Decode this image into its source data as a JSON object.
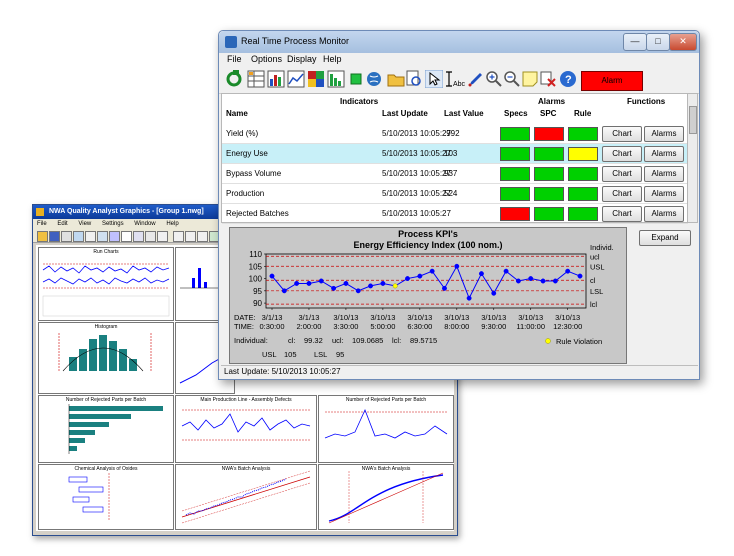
{
  "background_window": {
    "title": "NWA Quality Analyst Graphics - [Group 1.nwg]",
    "menu": [
      "File",
      "Edit",
      "View",
      "Settings",
      "Window",
      "Help"
    ],
    "cells": [
      {
        "title": "Run Charts"
      },
      {
        "title": ""
      },
      {
        "title": "Histogram"
      },
      {
        "title": ""
      },
      {
        "title": "Number of Rejected Parts per Batch"
      },
      {
        "title": "Main Production Line - Assembly Defects"
      },
      {
        "title": "Number of Rejected Parts per Batch"
      },
      {
        "title": "Chemical Analysis of Oxides"
      },
      {
        "title": "NWA's Batch Analysis"
      },
      {
        "title": "NWA's Batch Analysis"
      }
    ]
  },
  "window": {
    "title": "Real Time Process Monitor",
    "controls": {
      "minimize": "—",
      "maximize": "□",
      "close": "✕"
    }
  },
  "menu": [
    "File",
    "Options",
    "Display",
    "Help"
  ],
  "toolbar": {
    "alarm_label": "Alarm",
    "icons": [
      "refresh-icon",
      "table-icon",
      "bar-chart-icon",
      "grid-chart-icon",
      "color-grid-icon",
      "pareto-icon",
      "green-square-icon",
      "globe-icon",
      "open-folder-icon",
      "print-preview-icon",
      "pointer-icon",
      "text-cursor-icon",
      "pen-icon",
      "zoom-in-icon",
      "zoom-out-icon",
      "note-icon",
      "delete-icon",
      "help-icon",
      "stop-icon"
    ],
    "colors": {
      "alarm": "#ff0000"
    }
  },
  "indicators": {
    "group_headers": {
      "indicators": "Indicators",
      "alarms": "Alarms",
      "functions": "Functions"
    },
    "columns": {
      "name": "Name",
      "last_update": "Last Update",
      "last_value": "Last Value",
      "specs": "Specs",
      "spc": "SPC",
      "rule": "Rule"
    },
    "chart_button": "Chart",
    "alarms_button": "Alarms",
    "rows": [
      {
        "name": "Yield (%)",
        "last_update": "5/10/2013 10:05:27",
        "last_value": ".992",
        "specs": "#00d000",
        "spc": "#ff0000",
        "rule": "#00d000",
        "selected": false
      },
      {
        "name": "Energy Use",
        "last_update": "5/10/2013 10:05:27",
        "last_value": "103",
        "specs": "#00d000",
        "spc": "#00d000",
        "rule": "#ffff00",
        "selected": true
      },
      {
        "name": "Bypass Volume",
        "last_update": "5/10/2013 10:05:27",
        "last_value": "937",
        "specs": "#00d000",
        "spc": "#00d000",
        "rule": "#00d000",
        "selected": false
      },
      {
        "name": "Production",
        "last_update": "5/10/2013 10:05:27",
        "last_value": "524",
        "specs": "#00d000",
        "spc": "#00d000",
        "rule": "#00d000",
        "selected": false
      },
      {
        "name": "Rejected Batches",
        "last_update": "5/10/2013 10:05:27",
        "last_value": "",
        "specs": "#ff0000",
        "spc": "#00d000",
        "rule": "#00d000",
        "selected": false
      }
    ]
  },
  "expand_button": "Expand",
  "status_bar": "Last Update: 5/10/2013 10:05:27",
  "chart_data": {
    "type": "line",
    "title": "Process KPI's",
    "subtitle": "Energy Efficiency Index (100 nom.)",
    "ylim": [
      88,
      110
    ],
    "yticks": [
      90,
      95,
      100,
      105,
      110
    ],
    "values": [
      101,
      95,
      98,
      98,
      99,
      96,
      98,
      95,
      97,
      98,
      97,
      100,
      101,
      103,
      96,
      105,
      92,
      102,
      94,
      103,
      99,
      100,
      99,
      99,
      103,
      101
    ],
    "rule_violation_index": 10,
    "limits": {
      "ucl": 109.0685,
      "cl": 99.32,
      "lcl": 89.5715,
      "usl": 105,
      "lsl": 95
    },
    "right_labels": {
      "series": "Individ.",
      "ucl": "ucl",
      "usl": "USL",
      "cl": "cl",
      "lsl": "LSL",
      "lcl": "lcl"
    },
    "row_labels": {
      "date": "DATE:",
      "time": "TIME:"
    },
    "x_ticks": [
      {
        "index": 0,
        "date": "3/1/13",
        "time": "0:30:00"
      },
      {
        "index": 3,
        "date": "3/1/13",
        "time": "2:00:00"
      },
      {
        "index": 6,
        "date": "3/10/13",
        "time": "3:30:00"
      },
      {
        "index": 9,
        "date": "3/10/13",
        "time": "5:00:00"
      },
      {
        "index": 12,
        "date": "3/10/13",
        "time": "6:30:00"
      },
      {
        "index": 15,
        "date": "3/10/13",
        "time": "8:00:00"
      },
      {
        "index": 18,
        "date": "3/10/13",
        "time": "9:30:00"
      },
      {
        "index": 21,
        "date": "3/10/13",
        "time": "11:00:00"
      },
      {
        "index": 24,
        "date": "3/10/13",
        "time": "12:30:00"
      }
    ],
    "stats": {
      "label": "Individual:",
      "cl_label": "cl:",
      "cl": "99.32",
      "ucl_label": "ucl:",
      "ucl": "109.0685",
      "lcl_label": "lcl:",
      "lcl": "89.5715",
      "usl_label": "USL",
      "usl": "105",
      "lsl_label": "LSL",
      "lsl": "95"
    },
    "legend": "Rule Violation",
    "colors": {
      "line": "#0000ff",
      "marker": "#0000ff",
      "limit": "#cc0000",
      "violation": "#ffff00",
      "background": "#c8c8c8"
    }
  }
}
